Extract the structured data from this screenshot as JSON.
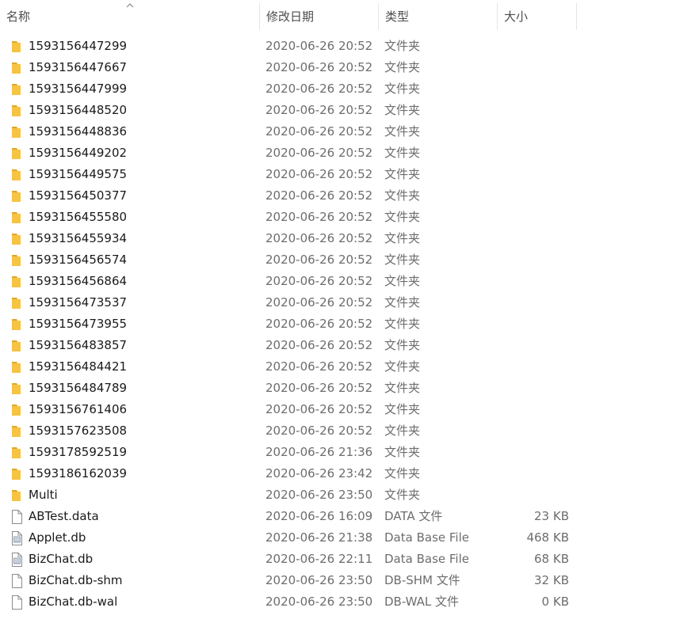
{
  "header": {
    "name": "名称",
    "date": "修改日期",
    "type": "类型",
    "size": "大小",
    "sort_icon": "chevron-up-icon"
  },
  "colors": {
    "folder": "#f6c343",
    "folder_dark": "#e0a72a",
    "text": "#1a1a1a",
    "muted": "#6d6d6d"
  },
  "files": [
    {
      "name": "1593156447299",
      "date": "2020-06-26 20:52",
      "type": "文件夹",
      "size": "",
      "icon": "folder-icon"
    },
    {
      "name": "1593156447667",
      "date": "2020-06-26 20:52",
      "type": "文件夹",
      "size": "",
      "icon": "folder-icon"
    },
    {
      "name": "1593156447999",
      "date": "2020-06-26 20:52",
      "type": "文件夹",
      "size": "",
      "icon": "folder-icon"
    },
    {
      "name": "1593156448520",
      "date": "2020-06-26 20:52",
      "type": "文件夹",
      "size": "",
      "icon": "folder-icon"
    },
    {
      "name": "1593156448836",
      "date": "2020-06-26 20:52",
      "type": "文件夹",
      "size": "",
      "icon": "folder-icon"
    },
    {
      "name": "1593156449202",
      "date": "2020-06-26 20:52",
      "type": "文件夹",
      "size": "",
      "icon": "folder-icon"
    },
    {
      "name": "1593156449575",
      "date": "2020-06-26 20:52",
      "type": "文件夹",
      "size": "",
      "icon": "folder-icon"
    },
    {
      "name": "1593156450377",
      "date": "2020-06-26 20:52",
      "type": "文件夹",
      "size": "",
      "icon": "folder-icon"
    },
    {
      "name": "1593156455580",
      "date": "2020-06-26 20:52",
      "type": "文件夹",
      "size": "",
      "icon": "folder-icon"
    },
    {
      "name": "1593156455934",
      "date": "2020-06-26 20:52",
      "type": "文件夹",
      "size": "",
      "icon": "folder-icon"
    },
    {
      "name": "1593156456574",
      "date": "2020-06-26 20:52",
      "type": "文件夹",
      "size": "",
      "icon": "folder-icon"
    },
    {
      "name": "1593156456864",
      "date": "2020-06-26 20:52",
      "type": "文件夹",
      "size": "",
      "icon": "folder-icon"
    },
    {
      "name": "1593156473537",
      "date": "2020-06-26 20:52",
      "type": "文件夹",
      "size": "",
      "icon": "folder-icon"
    },
    {
      "name": "1593156473955",
      "date": "2020-06-26 20:52",
      "type": "文件夹",
      "size": "",
      "icon": "folder-icon"
    },
    {
      "name": "1593156483857",
      "date": "2020-06-26 20:52",
      "type": "文件夹",
      "size": "",
      "icon": "folder-icon"
    },
    {
      "name": "1593156484421",
      "date": "2020-06-26 20:52",
      "type": "文件夹",
      "size": "",
      "icon": "folder-icon"
    },
    {
      "name": "1593156484789",
      "date": "2020-06-26 20:52",
      "type": "文件夹",
      "size": "",
      "icon": "folder-icon"
    },
    {
      "name": "1593156761406",
      "date": "2020-06-26 20:52",
      "type": "文件夹",
      "size": "",
      "icon": "folder-icon"
    },
    {
      "name": "1593157623508",
      "date": "2020-06-26 20:52",
      "type": "文件夹",
      "size": "",
      "icon": "folder-icon"
    },
    {
      "name": "1593178592519",
      "date": "2020-06-26 21:36",
      "type": "文件夹",
      "size": "",
      "icon": "folder-icon"
    },
    {
      "name": "1593186162039",
      "date": "2020-06-26 23:42",
      "type": "文件夹",
      "size": "",
      "icon": "folder-icon"
    },
    {
      "name": "Multi",
      "date": "2020-06-26 23:50",
      "type": "文件夹",
      "size": "",
      "icon": "folder-icon"
    },
    {
      "name": "ABTest.data",
      "date": "2020-06-26 16:09",
      "type": "DATA 文件",
      "size": "23 KB",
      "icon": "file-icon"
    },
    {
      "name": "Applet.db",
      "date": "2020-06-26 21:38",
      "type": "Data Base File",
      "size": "468 KB",
      "icon": "database-file-icon"
    },
    {
      "name": "BizChat.db",
      "date": "2020-06-26 22:11",
      "type": "Data Base File",
      "size": "68 KB",
      "icon": "database-file-icon"
    },
    {
      "name": "BizChat.db-shm",
      "date": "2020-06-26 23:50",
      "type": "DB-SHM 文件",
      "size": "32 KB",
      "icon": "file-icon"
    },
    {
      "name": "BizChat.db-wal",
      "date": "2020-06-26 23:50",
      "type": "DB-WAL 文件",
      "size": "0 KB",
      "icon": "file-icon"
    }
  ]
}
